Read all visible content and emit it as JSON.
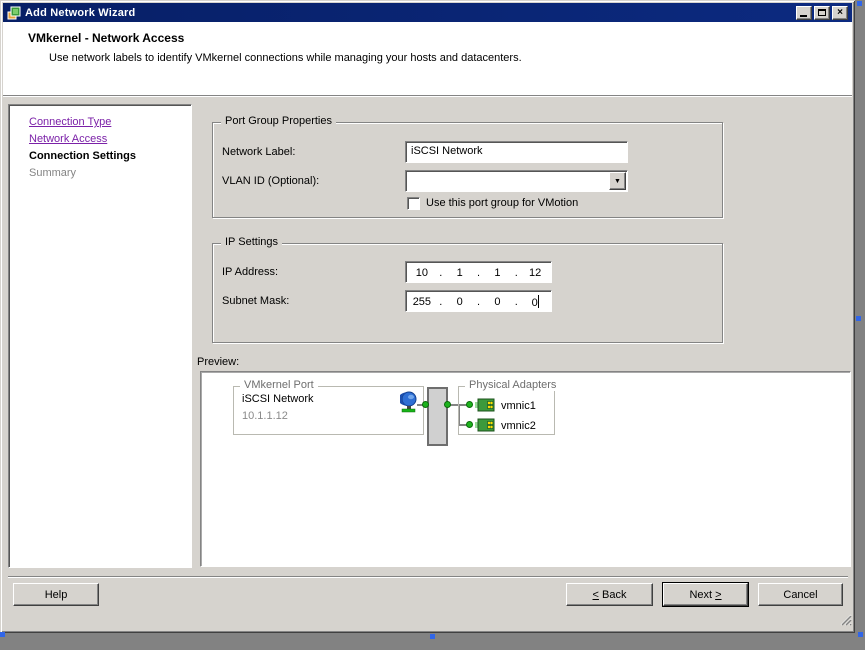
{
  "window": {
    "title": "Add Network Wizard",
    "controls": {
      "minimize": "minimize",
      "maximize": "maximize",
      "close": "×"
    }
  },
  "header": {
    "title": "VMkernel - Network Access",
    "description": "Use network labels to identify VMkernel connections while managing your hosts and datacenters."
  },
  "sidebar": {
    "steps": [
      {
        "label": "Connection Type",
        "state": "visited"
      },
      {
        "label": "Network Access",
        "state": "visited"
      },
      {
        "label": "Connection Settings",
        "state": "current"
      },
      {
        "label": "Summary",
        "state": "upcoming"
      }
    ]
  },
  "port_group_properties": {
    "group_title": "Port Group Properties",
    "network_label": {
      "label": "Network Label:",
      "value": "iSCSI Network"
    },
    "vlan_id": {
      "label": "VLAN ID (Optional):",
      "value": ""
    },
    "vmotion": {
      "label": "Use this port group for VMotion",
      "checked": false
    }
  },
  "ip_settings": {
    "group_title": "IP Settings",
    "separator": ".",
    "ip_address": {
      "label": "IP Address:",
      "octets": [
        "10",
        "1",
        "1",
        "12"
      ]
    },
    "subnet_mask": {
      "label": "Subnet Mask:",
      "octets": [
        "255",
        "0",
        "0",
        "0"
      ]
    }
  },
  "preview": {
    "label": "Preview:",
    "vmkernel_port": {
      "group_title": "VMkernel Port",
      "network_name": "iSCSI Network",
      "ip": "10.1.1.12"
    },
    "physical_adapters": {
      "group_title": "Physical Adapters",
      "adapters": [
        "vmnic1",
        "vmnic2"
      ]
    }
  },
  "buttons": {
    "help": "Help",
    "back": {
      "accelerator": "<",
      "rest": " Back"
    },
    "next": {
      "rest": "Next ",
      "accelerator": ">"
    },
    "cancel": "Cancel"
  },
  "icons": {
    "dropdown_arrow": "▼",
    "close": "×"
  },
  "colors": {
    "title_bar": "#0a2472",
    "face": "#d6d3ce",
    "link": "#7b21a8",
    "connection_green": "#1db31d",
    "desktop": "#828282",
    "selection_handle": "#3166e8"
  }
}
